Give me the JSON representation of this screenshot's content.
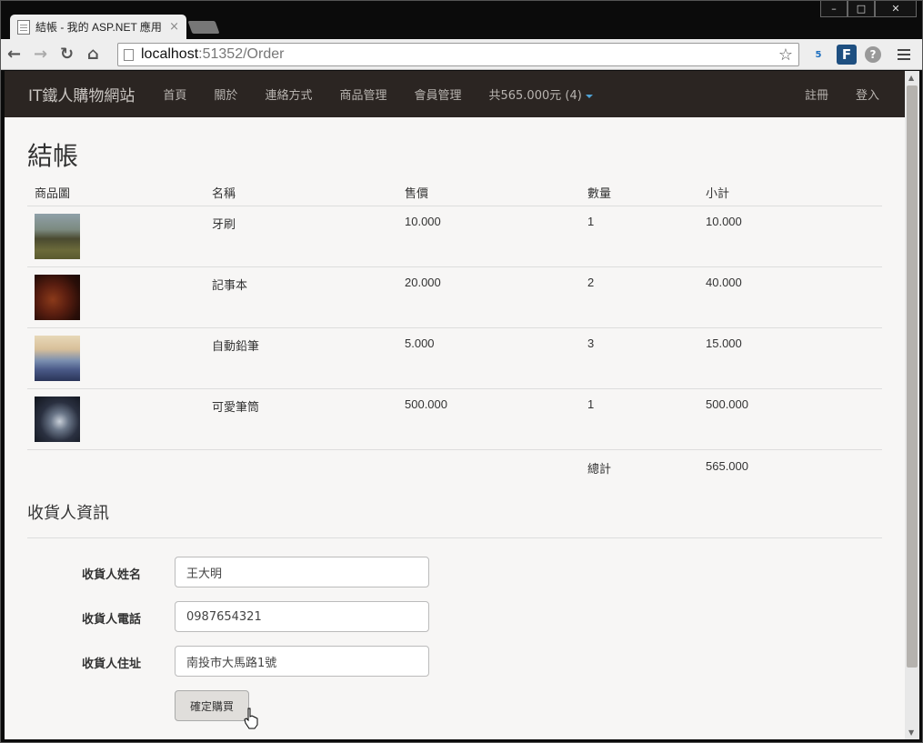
{
  "browser": {
    "tab_title": "結帳 - 我的 ASP.NET 應用",
    "tab_close": "×",
    "url_host": "localhost",
    "url_rest": ":51352/Order",
    "ext_badge": "5",
    "ext_f": "F",
    "ext_help": "?"
  },
  "navbar": {
    "brand": "IT鐵人購物網站",
    "links": [
      "首頁",
      "關於",
      "連絡方式",
      "商品管理",
      "會員管理"
    ],
    "cart": "共565.000元 (4)",
    "right": [
      "註冊",
      "登入"
    ]
  },
  "page": {
    "title": "結帳",
    "columns": [
      "商品圖",
      "名稱",
      "售價",
      "數量",
      "小計"
    ],
    "rows": [
      {
        "image": "car-image",
        "name": "牙刷",
        "price": "10.000",
        "qty": "1",
        "subtotal": "10.000"
      },
      {
        "image": "violin-image",
        "name": "記事本",
        "price": "20.000",
        "qty": "2",
        "subtotal": "40.000"
      },
      {
        "image": "matches-image",
        "name": "自動鉛筆",
        "price": "5.000",
        "qty": "3",
        "subtotal": "15.000"
      },
      {
        "image": "engine-image",
        "name": "可愛筆筒",
        "price": "500.000",
        "qty": "1",
        "subtotal": "500.000"
      }
    ],
    "total_label": "總計",
    "total_value": "565.000"
  },
  "receiver": {
    "section_title": "收貨人資訊",
    "name_label": "收貨人姓名",
    "name_value": "王大明",
    "phone_label": "收貨人電話",
    "phone_value": "0987654321",
    "address_label": "收貨人住址",
    "address_value": "南投市大馬路1號",
    "submit_label": "確定購買"
  },
  "colors": {
    "navbar_bg": "#2b2522",
    "page_bg": "#f7f6f5",
    "cart_caret": "#4fa3d6"
  }
}
